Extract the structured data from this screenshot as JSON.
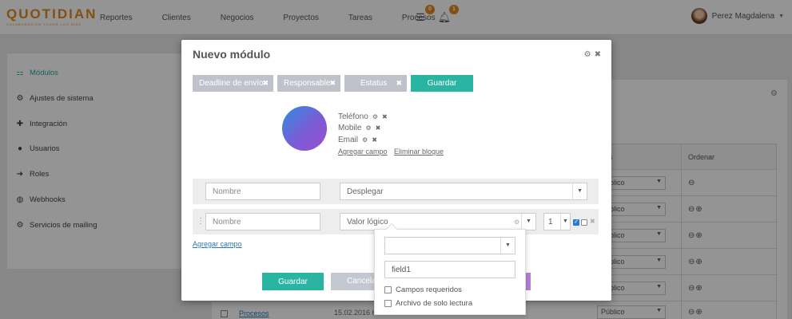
{
  "app": {
    "logo_text": "QUOTIDIAN",
    "logo_tagline": "COLABORACIÓN TODOS LOS DÍAS"
  },
  "nav": {
    "items": [
      "Reportes",
      "Clientes",
      "Negocios",
      "Proyectos",
      "Tareas",
      "Procesos"
    ],
    "inbox_count": "0",
    "notifications_count": "1",
    "user_name": "Perez Magdalena"
  },
  "sidebar": {
    "items": [
      {
        "label": "Módulos",
        "icon": "sitemap-icon"
      },
      {
        "label": "Ajustes de sistema",
        "icon": "gears-icon"
      },
      {
        "label": "Integración",
        "icon": "puzzle-icon"
      },
      {
        "label": "Usuarios",
        "icon": "user-icon"
      },
      {
        "label": "Roles",
        "icon": "arrow-right-icon"
      },
      {
        "label": "Webhooks",
        "icon": "globe-icon"
      },
      {
        "label": "Servicios de mailing",
        "icon": "gear-icon"
      }
    ]
  },
  "background_table": {
    "col_header_partial": "s",
    "col_ordenar": "Ordenar",
    "row_value": "Público",
    "bottom_link": "Procesos",
    "bottom_date": "15.02.2016 6:"
  },
  "modal": {
    "title": "Nuevo módulo",
    "chips": [
      "Deadline de envío",
      "Responsable",
      "Estatus"
    ],
    "save_label": "Guardar",
    "fields": [
      "Teléfono",
      "Mobile",
      "Email"
    ],
    "add_field_link": "Agregar campo",
    "delete_block_link": "Eliminar bloque",
    "row1": {
      "name_placeholder": "Nombre",
      "type_value": "Desplegar"
    },
    "row2": {
      "name_placeholder": "Nombre",
      "type_value": "Valor lógico",
      "number_value": "1"
    },
    "add_field_bottom": "Agregar campo",
    "footer_save": "Guardar",
    "footer_cancel": "Cancelar"
  },
  "popover": {
    "select_value": "",
    "text_value": "field1",
    "required_label": "Campos requeridos",
    "readonly_label": "Archivo de solo lectura"
  },
  "colors": {
    "brand": "#e08a1e",
    "accent": "#2ab5a3",
    "chip": "#bfc2ca"
  }
}
